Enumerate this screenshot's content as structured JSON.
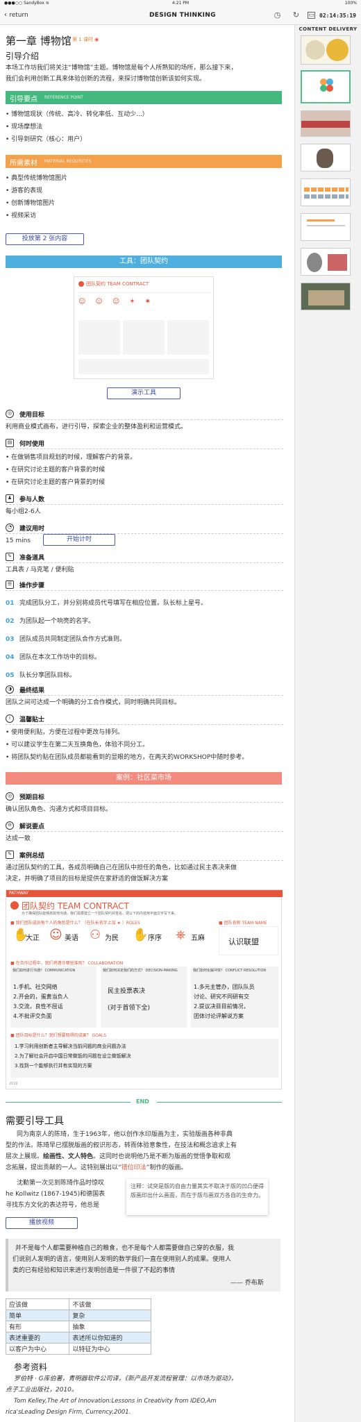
{
  "status": {
    "carrier": "●●●○○ SandyBox ≋",
    "time": "4:21 PM",
    "battery": "100%"
  },
  "nav": {
    "back": "return",
    "title": "DESIGN THINKING",
    "timer": "02:14:35:19"
  },
  "sidebar": {
    "header": "CONTENT DELIVERY"
  },
  "chapter": {
    "title": "第一章 博物馆",
    "meta": "第 1 课时"
  },
  "intro": {
    "title": "引导介绍",
    "text1": "本场工作坊我们将关注“博物馆”主题。博物馆是每个人所熟知的场所，那么接下来，",
    "text2": "我们会利用创新工具来体验创新的流程，来探讨博物馆创新该如何实现。"
  },
  "points_bar": {
    "title": "引导要点",
    "sub": "REFERENCE POINT",
    "color": "#43b97f"
  },
  "points": [
    "博物馆现状（传统、高冷、转化率低、互动少...）",
    "现场摩想法",
    "引导到研究（核心：用户）"
  ],
  "materials_bar": {
    "title": "所需素材",
    "sub": "MATERIAL REQUISITES",
    "color": "#f5a04a"
  },
  "materials": [
    "典型传统博物馆图片",
    "游客的表现",
    "创新博物馆图片",
    "视频采访"
  ],
  "btn_slide": "投放第 2 张内容",
  "tool_bar": {
    "title": "工具：团队契约",
    "color": "#4fb0e0"
  },
  "btn_demo": "演示工具",
  "contract_small": {
    "title": "团队契约 TEAM CONTRACT"
  },
  "usage": {
    "label": "使用目标",
    "text": "利用商业模式画布，进行引导，探索企业的整体盈利和运营模式。"
  },
  "when": {
    "label": "何时使用",
    "items": [
      "在做销售项目规划的时候，理解客户的背景。",
      "在研究讨论主题的客户背景的时候",
      "在研究讨论主题的客户背景的时候"
    ]
  },
  "people": {
    "label": "参与人数",
    "text": "每小组2-6人"
  },
  "duration": {
    "label": "建议用时",
    "text": "15 mins",
    "btn": "开始计时"
  },
  "prep": {
    "label": "准备道具",
    "text": "工具表 / 马克笔 / 便利贴"
  },
  "steps": {
    "label": "操作步骤",
    "items": [
      {
        "n": "01",
        "t": "完成团队分工，并分别将成员代号填写在相应位置。队长标上星号。"
      },
      {
        "n": "02",
        "t": "为团队起一个响亮的名字。"
      },
      {
        "n": "03",
        "t": "团队成员共同制定团队合作方式准则。"
      },
      {
        "n": "04",
        "t": "团队在本次工作坊中的目标。"
      },
      {
        "n": "05",
        "t": "队长分享团队目标。"
      }
    ]
  },
  "result": {
    "label": "最终结果",
    "text": "团队之间可达成一个明确的分工合作模式，同时明确共同目标。"
  },
  "tips": {
    "label": "温馨贴士",
    "items": [
      "使用便利贴，方便在过程中更改与排列。",
      "可以建议学生在第二天互换角色，体验不同分工。",
      "将团队契约贴在团队成员都能看到的显眼的地方，在两天的WORKSHOP中随时参考。"
    ]
  },
  "case_bar": {
    "title": "案例：社区菜市场",
    "color": "#f28a7e"
  },
  "case_goal": {
    "label": "预期目标",
    "text": "确认团队角色、沟通方式和项目目标。"
  },
  "case_points": {
    "label": "解说要点",
    "text": "达成一致"
  },
  "case_summary": {
    "label": "案例总结",
    "text1": "通过团队契约的工具，各成员明确自己在团队中担任的角色，比如通过民主表决来做",
    "text2": "决定，并明确了项目的目标是提供在家舒适的做饭解决方案"
  },
  "contract": {
    "tag": "PATHWAY",
    "title": "团队契约 TEAM CONTRACT",
    "subtitle": "为了确保团队能够高效地沟通，我们需要建立一个团队契约并签名，把以下的内容用平面文字写下来。",
    "roles_label": "我们团队成员每个人的角色是什么？（在队长名字上加 ★ ）ROLES",
    "name_label": "团队名称 TEAM NAME",
    "team_name": "认识联盟",
    "roles": [
      "大正",
      "美语",
      "为民",
      "序序",
      "五麻"
    ],
    "collab_label": "在合作过程中，我们将遵守哪些准则？ COLLABORATION",
    "comm_label": "我们如何进行沟通？ COMMUNICATION",
    "decision_label": "我们如何决定我们的方式？ DECISION-MAKING",
    "conflict_label": "我们如何化解冲突？ CONFLICT RESOLUTION",
    "comm_items": [
      "1.手机、社交网络",
      "2.开会的，蛋黄当负人",
      "3.交流，良性不屈话",
      "4.不批评交负面"
    ],
    "decision_items": [
      "民主投票表决",
      "(对于首领下全)"
    ],
    "conflict_items": [
      "1.多元主管办，团队队员",
      "讨论、研究不同研有交",
      "2.提议决目目前情况，",
      "团体讨论评解说方案"
    ],
    "goals_label": "团队目标是什么？我们想要取得的成果？ GOALS",
    "goals": [
      "1.学习利用创新者主导解决当前问题的商业问题办法",
      "2.为了解社会开启中国日常做饭的问题在设立做饭解决",
      "3.找到一个能够执行并有实现的方案"
    ],
    "date": "2016"
  },
  "end_label": "END",
  "guide": {
    "title": "需要引导工具",
    "p1": "同为南京人的陈琦，生于1963年，他以创作水印版画为主，实验版画各种非典",
    "p2": "型的作法。陈琦早已摆脱版画的叙识形态，转而体验意象性，在技法和概念追求上有",
    "p3a": "层次上展现。",
    "p3b": "绘画性、文人特色",
    "p3c": "。这同时也说明他乃是不断为版画的觉悟争取和观",
    "p4a": "念拓展，提出贡献的一人。这特别展出以“",
    "p4b": "错位印法",
    "p4c": "”制作的版画。",
    "p5": "沈勤第一次见到陈琦作品时惊叹",
    "p6": "he Kollwitz (1867-1945)和德国表",
    "p7": "寻找东方文化的表达符号，他总是",
    "note": "注释：试突是版的自由力量其实不取决于版的凹凸便得版画印出什么画面，而在于版与画双方各自的生命力。",
    "btn_video": "播放视频"
  },
  "quote": {
    "text1": "并不是每个人都需要种植自己的粮食，也不是每个人都需要做自己穿的衣服，我",
    "text2": "们说别人发明的语言，使用别人发明的数学我们一直在使用别人的成果。使用人",
    "text3": "类的已有经验和知识来进行发明创造是一件很了不起的事情",
    "author": "——  乔布斯"
  },
  "table": {
    "header": [
      "应该做",
      "不该做"
    ],
    "rows": [
      [
        "简单",
        "复杂"
      ],
      [
        "有形",
        "抽象"
      ],
      [
        "表述重要的",
        "表述所以你知道的"
      ],
      [
        "以客户为中心",
        "以特征为中心"
      ]
    ]
  },
  "refs": {
    "title": "参考资料",
    "r1": "Tom Kelley,The Art of Innovation:Lessons in Creativity from IDEO,Am",
    "r2": "rica'sLeading Design Firm, Currency,2001.",
    "r0a": "罗伯特 · G库伯著，青明器软件公司译，《新产品开发流程管理：以市场为驱动》，",
    "r0b": "点子工业出版社，2010。"
  },
  "colors": {
    "green": "#43b97f",
    "orange": "#f5a04a",
    "blue": "#4fb0e0",
    "red": "#f28a7e",
    "accent": "#e5563a"
  }
}
